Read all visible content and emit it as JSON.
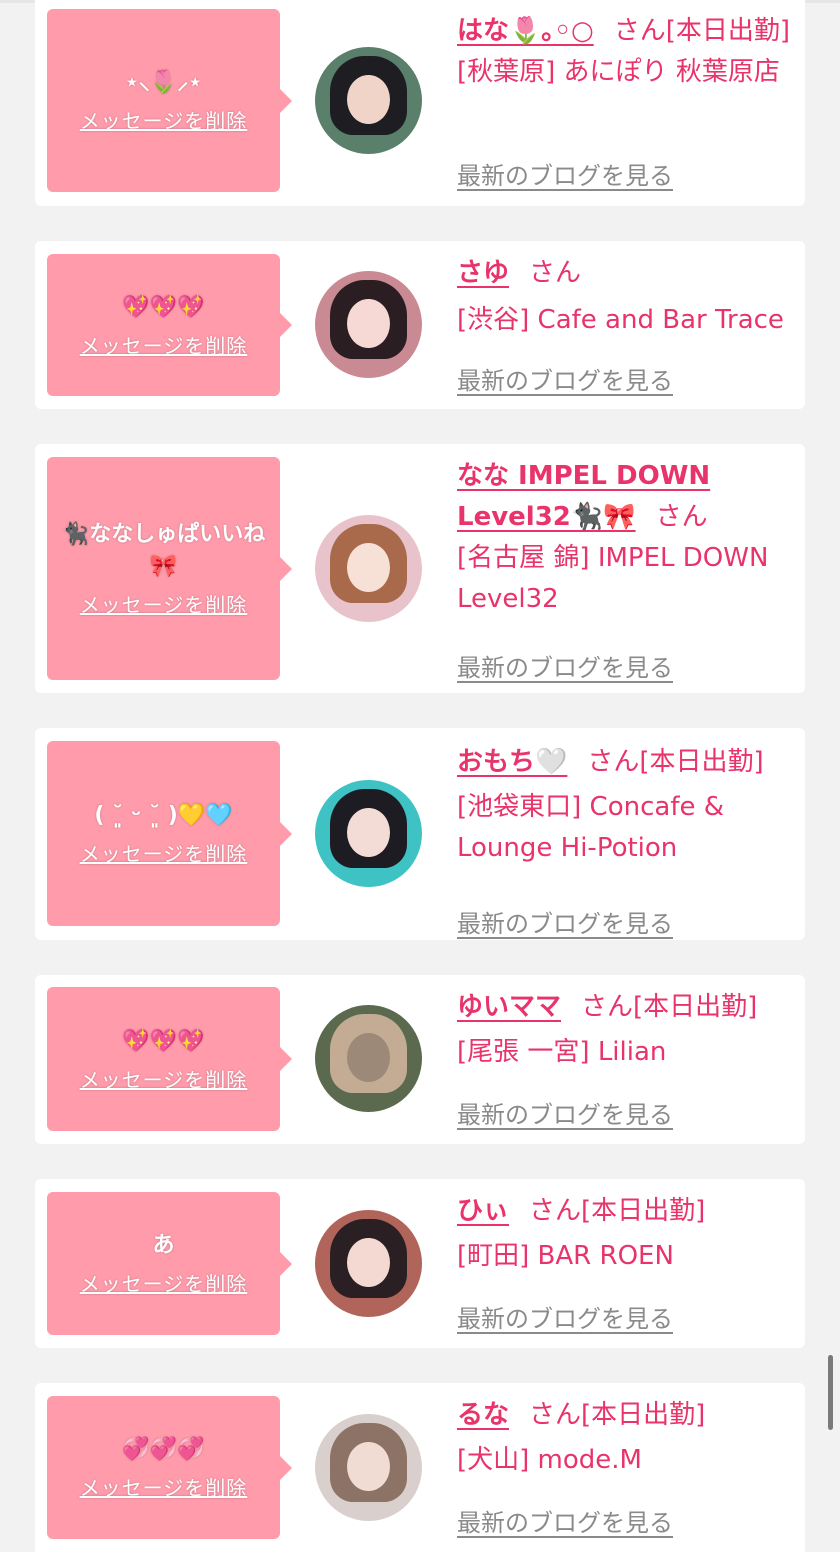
{
  "delete_label": "メッセージを削除",
  "blog_label": "最新のブログを見る",
  "san_label": "さん",
  "colors": {
    "accent": "#e8336b",
    "bubble": "#ff9bab",
    "background": "#f2f2f2",
    "link_gray": "#8a8a8a"
  },
  "cards": [
    {
      "message": "⋆⸜🌷⸝⋆",
      "name": "はな🌷｡◦○",
      "status": "[本日出勤]",
      "shop": "[秋葉原] あにぽり 秋葉原店"
    },
    {
      "message": "💖💖💖",
      "name": "さゆ",
      "status": "",
      "shop": "[渋谷] Cafe and Bar Trace"
    },
    {
      "message": "🐈‍⬛ななしゅぱいいね🎀",
      "name": "なな IMPEL DOWN Level32🐈‍⬛🎀",
      "status": "",
      "shop": "[名古屋 錦] IMPEL DOWN Level32"
    },
    {
      "message": "( ˘͈ ᵕ ˘͈ )💛🩵",
      "name": "おもち🤍",
      "status": "[本日出勤]",
      "shop": "[池袋東口] Concafe & Lounge Hi-Potion"
    },
    {
      "message": "💖💖💖",
      "name": "ゆいママ",
      "status": "[本日出勤]",
      "shop": "[尾張 一宮] Lilian"
    },
    {
      "message": "あ",
      "name": "ひぃ",
      "status": "[本日出勤]",
      "shop": "[町田] BAR ROEN"
    },
    {
      "message": "💞💞💞",
      "name": "るな",
      "status": "[本日出勤]",
      "shop": "[犬山] mode.M"
    }
  ]
}
